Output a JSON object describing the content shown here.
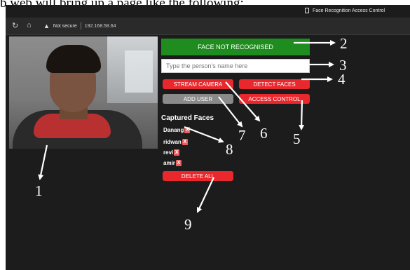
{
  "caption": "b web will bring up a page like the following:",
  "browser": {
    "tab_title": "Face Recognition Access Control",
    "security_label": "Not secure",
    "url": "192.168.58.64"
  },
  "camera": {
    "icon": "webcam-feed"
  },
  "status_banner": {
    "text": "FACE NOT RECOGNISED",
    "color": "#1f8c1f"
  },
  "name_input": {
    "placeholder": "Type the person's name here",
    "value": ""
  },
  "buttons": {
    "stream_camera": "STREAM CAMERA",
    "detect_faces": "DETECT FACES",
    "add_user": "ADD USER",
    "access_control": "ACCESS CONTROL",
    "delete_all": "DELETE ALL"
  },
  "captured_faces": {
    "title": "Captured Faces",
    "items": [
      {
        "name": "Danang",
        "remove": "X"
      },
      {
        "name": "ridwan",
        "remove": "X"
      },
      {
        "name": "revi",
        "remove": "X"
      },
      {
        "name": "amir",
        "remove": "X"
      }
    ]
  },
  "annotations": [
    "1",
    "2",
    "3",
    "4",
    "5",
    "6",
    "7",
    "8",
    "9"
  ],
  "colors": {
    "red_button": "#e8282d",
    "gray_button": "#8a8a8a",
    "page_bg": "#1c1c1c"
  }
}
